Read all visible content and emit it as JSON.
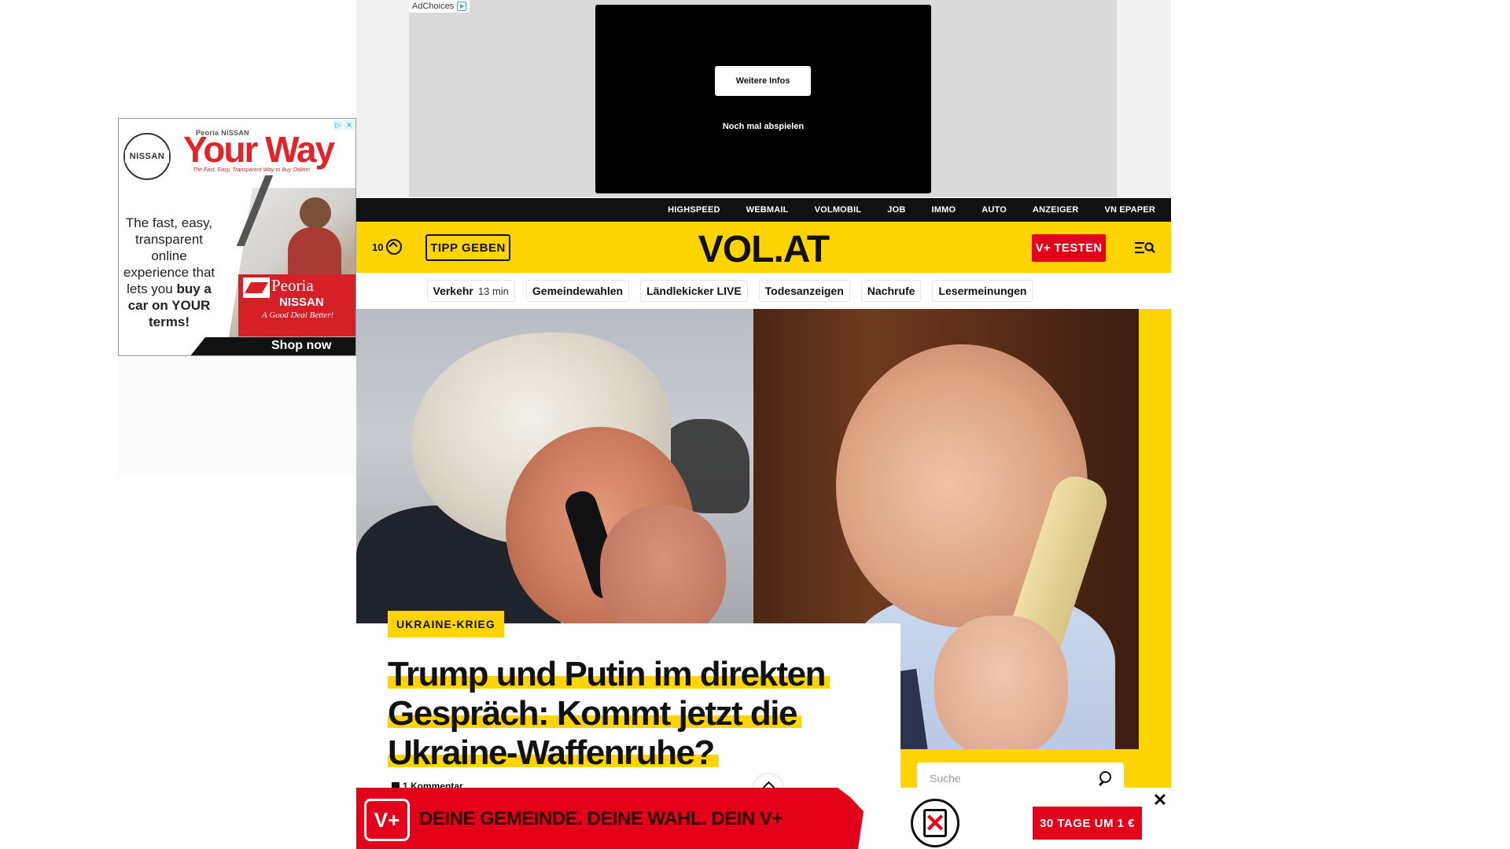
{
  "top_ad": {
    "adchoices_label": "AdChoices",
    "video": {
      "more_info_label": "Weitere Infos",
      "replay_label": "Noch mal abspielen"
    }
  },
  "side_ad": {
    "brand_logo_text": "NISSAN",
    "dealer_small": "Peoria NISSAN",
    "headline": "Your Way",
    "tagline": "The Fast, Easy, Transparent Way to Buy Online!",
    "body_line1": "The fast, easy, transparent online experience that lets you",
    "body_line2": "buy a car on YOUR terms!",
    "dealer_name": "Peoria",
    "dealer_brand": "NISSAN",
    "dealer_slogan": "A Good Deal Better!",
    "cta": "Shop now"
  },
  "service_nav": [
    "HIGHSPEED",
    "WEBMAIL",
    "VOLMOBIL",
    "JOB",
    "IMMO",
    "AUTO",
    "ANZEIGER",
    "VN EPAPER"
  ],
  "header": {
    "weather_temp": "10",
    "weather_icon": "weather-icon",
    "tip_label": "TIPP GEBEN",
    "logo": "VOL.AT",
    "subscribe_label": "V+ TESTEN",
    "menu_icon": "menu-search-icon"
  },
  "chips": [
    {
      "label": "Verkehr",
      "sub": "13 min"
    },
    {
      "label": "Gemeindewahlen"
    },
    {
      "label": "Ländlekicker LIVE"
    },
    {
      "label": "Todesanzeigen"
    },
    {
      "label": "Nachrufe"
    },
    {
      "label": "Lesermeinungen"
    }
  ],
  "article": {
    "category": "UKRAINE-KRIEG",
    "headline_line1": "Trump und Putin im direkten",
    "headline_line2": "Gespräch: Kommt jetzt die",
    "headline_line3": "Ukraine-Waffenruhe?",
    "comment_count": "1 Kommentar"
  },
  "search": {
    "placeholder": "Suche"
  },
  "bottom_banner": {
    "badge": "V+",
    "slogan": "DEINE GEMEINDE. DEINE WAHL. DEIN V+",
    "cta": "30 TAGE UM 1 €",
    "close": "✕"
  },
  "colors": {
    "brand_yellow": "#ffd400",
    "brand_red": "#e3001b",
    "service_bar": "#111111"
  }
}
